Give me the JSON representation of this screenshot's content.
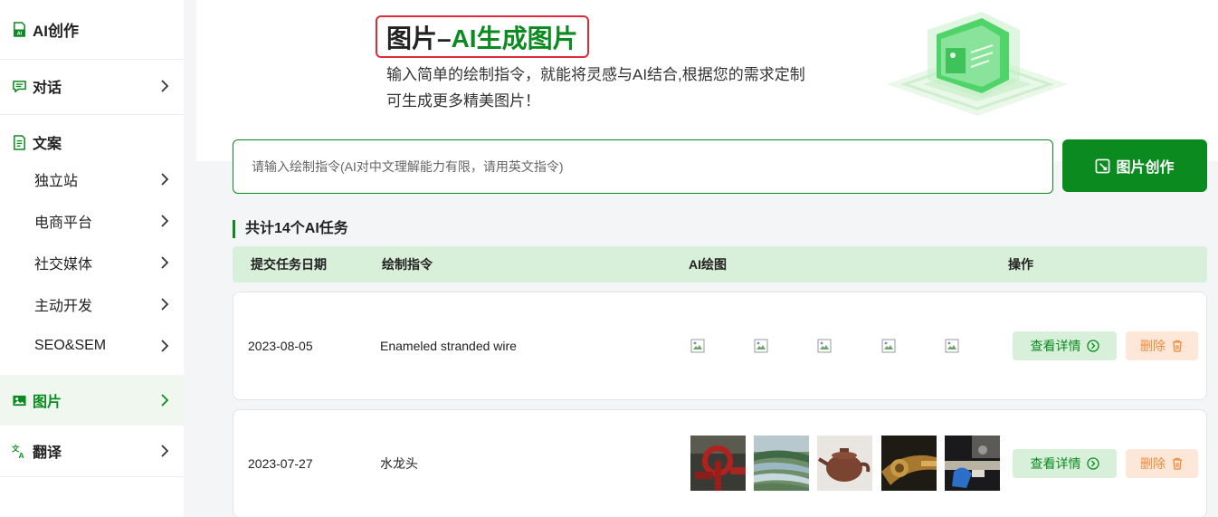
{
  "sidebar": {
    "header": "AI创作",
    "items": [
      {
        "label": "对话"
      },
      {
        "label": "文案"
      },
      {
        "label": "独立站"
      },
      {
        "label": "电商平台"
      },
      {
        "label": "社交媒体"
      },
      {
        "label": "主动开发"
      },
      {
        "label": "SEO&SEM"
      },
      {
        "label": "图片"
      },
      {
        "label": "翻译"
      }
    ]
  },
  "hero": {
    "title_prefix": "图片–",
    "title_highlight": "AI生成图片",
    "desc_line1": "输入简单的绘制指令，就能将灵感与AI结合,根据您的需求定制",
    "desc_line2": "可生成更多精美图片！"
  },
  "prompt": {
    "placeholder": "请输入绘制指令(AI对中文理解能力有限，请用英文指令)"
  },
  "create_button": "图片创作",
  "task_count_label": "共计14个AI任务",
  "table": {
    "headers": [
      "提交任务日期",
      "绘制指令",
      "AI绘图",
      "操作"
    ],
    "rows": [
      {
        "date": "2023-08-05",
        "command": "Enameled stranded wire",
        "images": "broken"
      },
      {
        "date": "2023-07-27",
        "command": "水龙头",
        "images": "photos"
      }
    ],
    "detail_label": "查看详情",
    "delete_label": "删除"
  },
  "colors": {
    "brand": "#0a8a1f",
    "header_bg": "#d8efd9",
    "delete_text": "#f08a3a",
    "delete_bg": "#fde7d9",
    "title_border": "#e02c3a"
  }
}
